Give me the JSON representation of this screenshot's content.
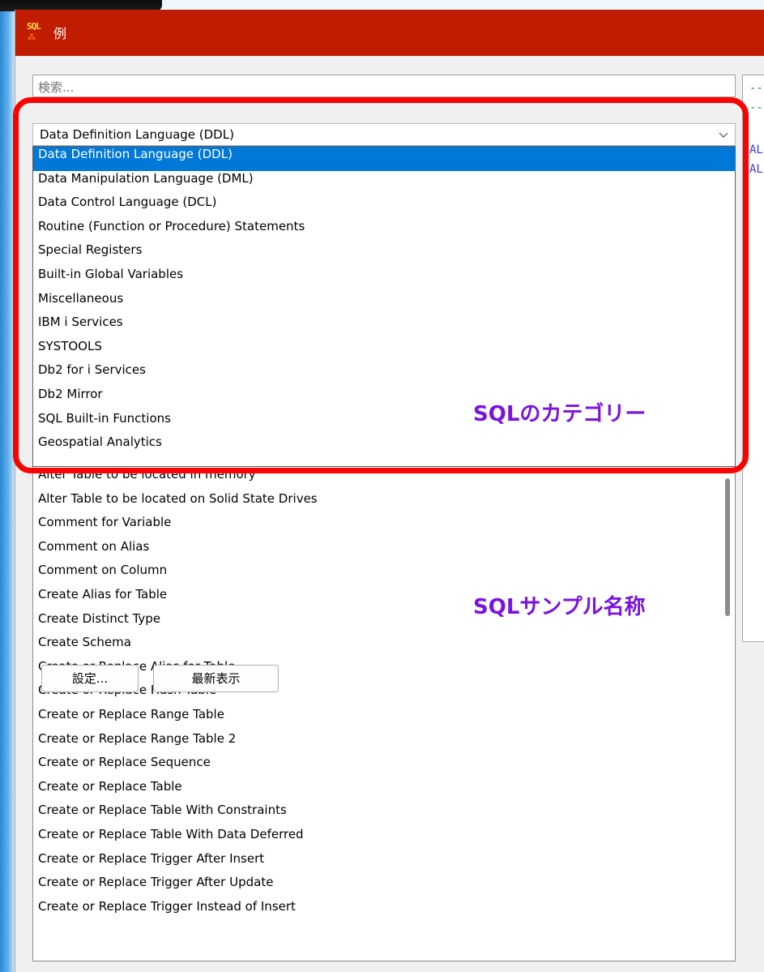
{
  "window": {
    "title": "例",
    "icon_text": "SQL"
  },
  "search": {
    "placeholder": "検索..."
  },
  "category": {
    "selected": "Data Definition Language (DDL)",
    "options": [
      "Data Definition Language (DDL)",
      "Data Manipulation Language (DML)",
      "Data Control Language (DCL)",
      "Routine (Function or Procedure) Statements",
      "Special Registers",
      "Built-in Global Variables",
      "Miscellaneous",
      "IBM i Services",
      "SYSTOOLS",
      "Db2 for i Services",
      "Db2 Mirror",
      "SQL Built-in Functions",
      "Geospatial Analytics"
    ]
  },
  "samples": {
    "items": [
      "Alter Table to be located in memory",
      "Alter Table to be located on Solid State Drives",
      "Comment for Variable",
      "Comment on Alias",
      "Comment on Column",
      "Create Alias for Table",
      "Create Distinct Type",
      "Create Schema",
      "Create or Replace Alias for Table",
      "Create or Replace Hash Table",
      "Create or Replace Range Table",
      "Create or Replace Range Table 2",
      "Create or Replace Sequence",
      "Create or Replace Table",
      "Create or Replace Table With Constraints",
      "Create or Replace Table With Data Deferred",
      "Create or Replace Trigger After Insert",
      "Create or Replace Trigger After Update",
      "Create or Replace Trigger Instead of Insert"
    ]
  },
  "editor": {
    "lines": [
      "--",
      "--",
      "AL",
      "AL"
    ],
    "comment_color": "#2e8b2e",
    "keyword_color": "#3a3adb"
  },
  "buttons": {
    "settings": "設定...",
    "refresh": "最新表示"
  },
  "annotations": {
    "category_label": "SQLのカテゴリー",
    "sample_label": "SQLサンプル名称"
  },
  "colors": {
    "titlebar": "#c01d00",
    "selection": "#0078d7",
    "highlight_border": "#ff0000",
    "annotation_text": "#7a14dd"
  }
}
